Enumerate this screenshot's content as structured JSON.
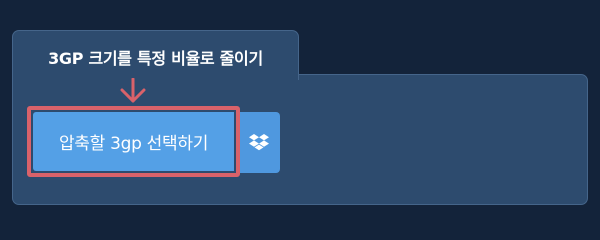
{
  "tab": {
    "title": "3GP 크기를 특정 비율로 줄이기"
  },
  "upload": {
    "button_label": "압축할 3gp 선택하기"
  },
  "dropbox": {
    "icon": "dropbox-icon"
  },
  "colors": {
    "page_background": "#13233a",
    "panel": "#2d4b6e",
    "button": "#54a0e6",
    "highlight": "#d9626a"
  }
}
